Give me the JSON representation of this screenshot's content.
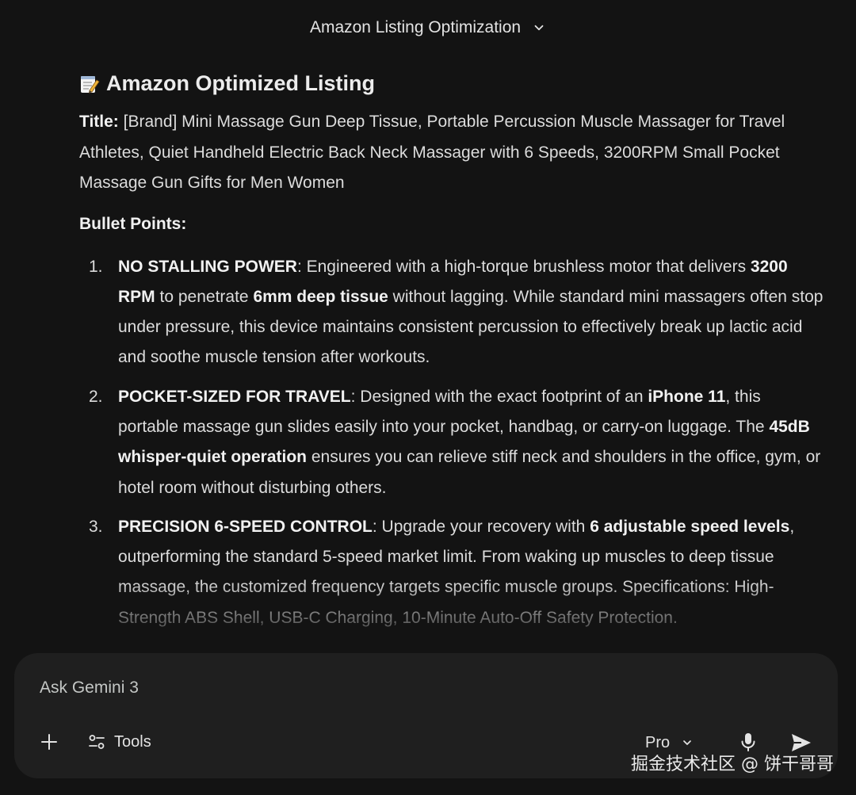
{
  "header": {
    "chat_title": "Amazon Listing Optimization"
  },
  "listing": {
    "heading": "Amazon Optimized Listing",
    "heading_icon": "memo-icon",
    "title_label": "Title:",
    "title_text": " [Brand] Mini Massage Gun Deep Tissue, Portable Percussion Muscle Massager for Travel Athletes, Quiet Handheld Electric Back Neck Massager with 6 Speeds, 3200RPM Small Pocket Massage Gun Gifts for Men Women",
    "bullets_label": "Bullet Points:",
    "bullets": [
      {
        "number": "1.",
        "parts": [
          {
            "text": "NO STALLING POWER",
            "bold": true
          },
          {
            "text": ": Engineered with a high-torque brushless motor that delivers ",
            "bold": false
          },
          {
            "text": "3200 RPM",
            "bold": true
          },
          {
            "text": " to penetrate ",
            "bold": false
          },
          {
            "text": "6mm deep tissue",
            "bold": true
          },
          {
            "text": " without lagging. While standard mini massagers often stop under pressure, this device maintains consistent percussion to effectively break up lactic acid and soothe muscle tension after workouts.",
            "bold": false
          }
        ]
      },
      {
        "number": "2.",
        "parts": [
          {
            "text": "POCKET-SIZED FOR TRAVEL",
            "bold": true
          },
          {
            "text": ": Designed with the exact footprint of an ",
            "bold": false
          },
          {
            "text": "iPhone 11",
            "bold": true
          },
          {
            "text": ", this portable massage gun slides easily into your pocket, handbag, or carry-on luggage. The ",
            "bold": false
          },
          {
            "text": "45dB whisper-quiet operation",
            "bold": true
          },
          {
            "text": " ensures you can relieve stiff neck and shoulders in the office, gym, or hotel room without disturbing others.",
            "bold": false
          }
        ]
      },
      {
        "number": "3.",
        "parts": [
          {
            "text": "PRECISION 6-SPEED CONTROL",
            "bold": true
          },
          {
            "text": ": Upgrade your recovery with ",
            "bold": false
          },
          {
            "text": "6 adjustable speed levels",
            "bold": true
          },
          {
            "text": ", outperforming the standard 5-speed market limit. From waking up muscles to deep tissue massage, the customized frequency targets specific muscle groups. Specifications: High-Strength ABS Shell, USB-C Charging, 10-Minute Auto-Off Safety Protection.",
            "bold": false
          }
        ]
      }
    ]
  },
  "input": {
    "placeholder": "Ask Gemini 3",
    "tools_label": "Tools",
    "model_label": "Pro"
  },
  "icons": {
    "add": "plus-icon",
    "tools": "tools-sliders-icon",
    "model_dropdown": "chevron-down-icon",
    "mic": "microphone-icon",
    "send": "send-icon"
  },
  "watermark": "掘金技术社区 @ 饼干哥哥",
  "colors": {
    "background": "#131313",
    "input_background": "#1f1f1f",
    "text": "#e3e3e3"
  }
}
